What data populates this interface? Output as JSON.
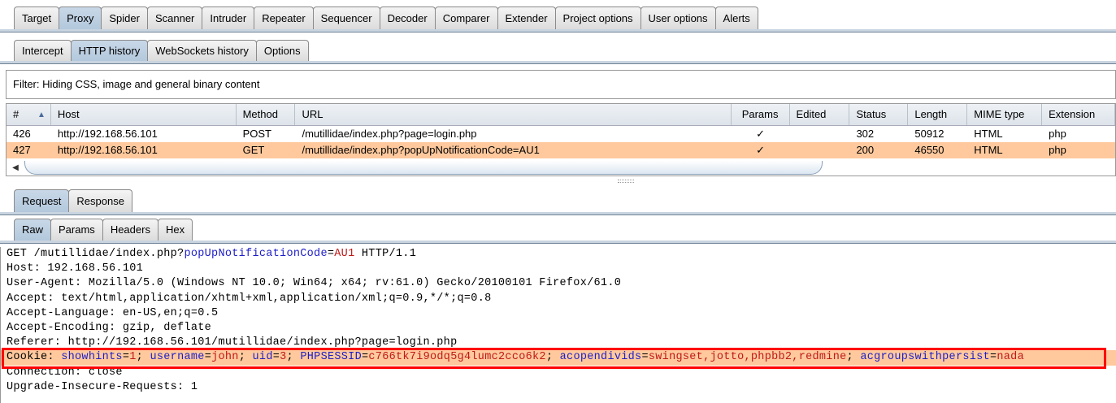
{
  "main_tabs": [
    "Target",
    "Proxy",
    "Spider",
    "Scanner",
    "Intruder",
    "Repeater",
    "Sequencer",
    "Decoder",
    "Comparer",
    "Extender",
    "Project options",
    "User options",
    "Alerts"
  ],
  "main_active": 1,
  "sub_tabs": [
    "Intercept",
    "HTTP history",
    "WebSockets history",
    "Options"
  ],
  "sub_active": 1,
  "filter": "Filter: Hiding CSS, image and general binary content",
  "table": {
    "columns": [
      "#",
      "Host",
      "Method",
      "URL",
      "Params",
      "Edited",
      "Status",
      "Length",
      "MIME type",
      "Extension"
    ],
    "rows": [
      [
        "426",
        "http://192.168.56.101",
        "POST",
        "/mutillidae/index.php?page=login.php",
        "✓",
        "",
        "302",
        "50912",
        "HTML",
        "php"
      ],
      [
        "427",
        "http://192.168.56.101",
        "GET",
        "/mutillidae/index.php?popUpNotificationCode=AU1",
        "✓",
        "",
        "200",
        "46550",
        "HTML",
        "php"
      ]
    ],
    "selected_row": 1
  },
  "rr_tabs": [
    "Request",
    "Response"
  ],
  "view_tabs": [
    "Raw",
    "Params",
    "Headers",
    "Hex"
  ],
  "request_lines": [
    [
      [
        "t",
        "GET /mutillidae/index.php?"
      ],
      [
        "n",
        "popUpNotificationCode"
      ],
      [
        "t",
        "="
      ],
      [
        "v",
        "AU1"
      ],
      [
        "t",
        " HTTP/1.1"
      ]
    ],
    [
      [
        "t",
        "Host: 192.168.56.101"
      ]
    ],
    [
      [
        "t",
        "User-Agent: Mozilla/5.0 (Windows NT 10.0; Win64; x64; rv:61.0) Gecko/20100101 Firefox/61.0"
      ]
    ],
    [
      [
        "t",
        "Accept: text/html,application/xhtml+xml,application/xml;q=0.9,*/*;q=0.8"
      ]
    ],
    [
      [
        "t",
        "Accept-Language: en-US,en;q=0.5"
      ]
    ],
    [
      [
        "t",
        "Accept-Encoding: gzip, deflate"
      ]
    ],
    [
      [
        "t",
        "Referer: http://192.168.56.101/mutillidae/index.php?page=login.php"
      ]
    ],
    [
      [
        "t",
        "Cookie: "
      ],
      [
        "n",
        "showhints"
      ],
      [
        "t",
        "="
      ],
      [
        "v",
        "1"
      ],
      [
        "t",
        "; "
      ],
      [
        "n",
        "username"
      ],
      [
        "t",
        "="
      ],
      [
        "v",
        "john"
      ],
      [
        "t",
        "; "
      ],
      [
        "n",
        "uid"
      ],
      [
        "t",
        "="
      ],
      [
        "v",
        "3"
      ],
      [
        "t",
        "; "
      ],
      [
        "n",
        "PHPSESSID"
      ],
      [
        "t",
        "="
      ],
      [
        "v",
        "c766tk7i9odq5g4lumc2cco6k2"
      ],
      [
        "t",
        "; "
      ],
      [
        "n",
        "acopendivids"
      ],
      [
        "t",
        "="
      ],
      [
        "v",
        "swingset,jotto,phpbb2,redmine"
      ],
      [
        "t",
        "; "
      ],
      [
        "n",
        "acgroupswithpersist"
      ],
      [
        "t",
        "="
      ],
      [
        "v",
        "nada"
      ]
    ],
    [
      [
        "t",
        "Connection: close"
      ]
    ],
    [
      [
        "t",
        "Upgrade-Insecure-Requests: 1"
      ]
    ]
  ],
  "highlight_line": 7,
  "colors": {
    "selection": "#ffc99d",
    "param_name": "#1e1ec8",
    "param_value": "#c01818",
    "highlight_box": "#ff0000"
  }
}
